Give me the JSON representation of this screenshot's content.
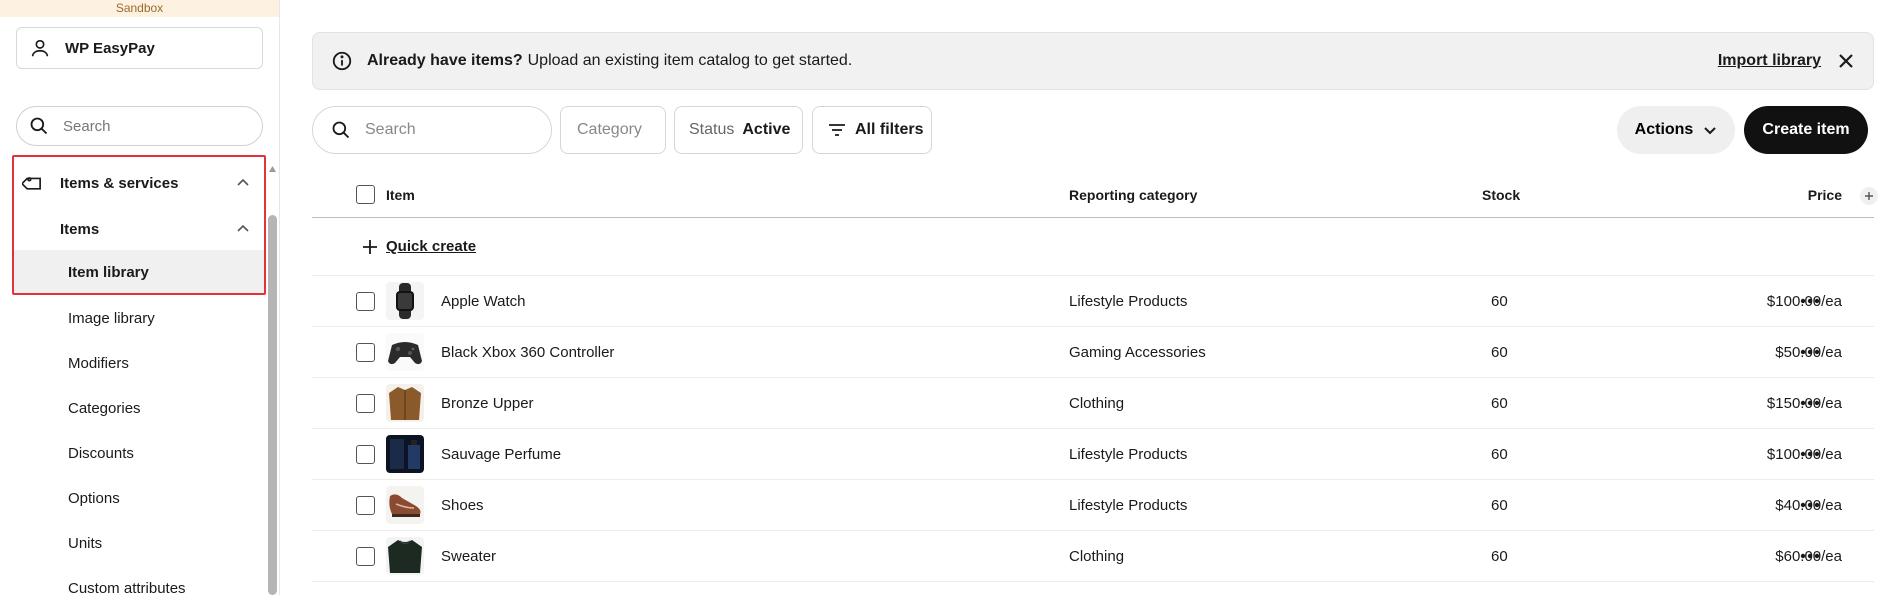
{
  "sidebar": {
    "sandbox_label": "Sandbox",
    "account_name": "WP EasyPay",
    "search_placeholder": "Search",
    "group_label": "Items & services",
    "sub_label": "Items",
    "active_label": "Item library",
    "items": [
      {
        "label": "Image library"
      },
      {
        "label": "Modifiers"
      },
      {
        "label": "Categories"
      },
      {
        "label": "Discounts"
      },
      {
        "label": "Options"
      },
      {
        "label": "Units"
      },
      {
        "label": "Custom attributes"
      }
    ]
  },
  "banner": {
    "strong_text": "Already have items?",
    "text": "Upload an existing item catalog to get started.",
    "import_label": "Import library"
  },
  "filters": {
    "search_placeholder": "Search",
    "category_label": "Category",
    "status_label": "Status",
    "status_value": "Active",
    "all_filters_label": "All filters",
    "actions_label": "Actions",
    "create_label": "Create item"
  },
  "table": {
    "headers": {
      "item": "Item",
      "reporting_category": "Reporting category",
      "stock": "Stock",
      "price": "Price"
    },
    "quick_create_label": "Quick create",
    "rows": [
      {
        "name": "Apple Watch",
        "category": "Lifestyle Products",
        "stock": "60",
        "price": "$100.00/ea"
      },
      {
        "name": "Black Xbox 360 Controller",
        "category": "Gaming Accessories",
        "stock": "60",
        "price": "$50.00/ea"
      },
      {
        "name": "Bronze Upper",
        "category": "Clothing",
        "stock": "60",
        "price": "$150.00/ea"
      },
      {
        "name": "Sauvage Perfume",
        "category": "Lifestyle Products",
        "stock": "60",
        "price": "$100.00/ea"
      },
      {
        "name": "Shoes",
        "category": "Lifestyle Products",
        "stock": "60",
        "price": "$40.00/ea"
      },
      {
        "name": "Sweater",
        "category": "Clothing",
        "stock": "60",
        "price": "$60.00/ea"
      }
    ]
  },
  "colors": {
    "accent_dark": "#111111",
    "highlight_outline": "#e0343a",
    "sandbox_bg": "#fdf1e2"
  }
}
